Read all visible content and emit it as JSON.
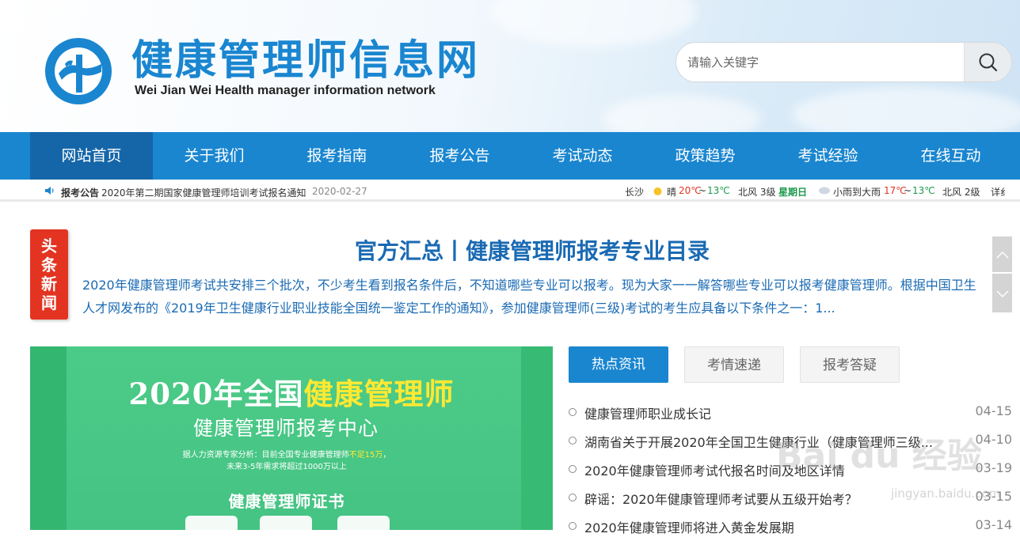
{
  "header": {
    "title": "健康管理师信息网",
    "subtitle": "Wei Jian Wei Health manager information network",
    "search_placeholder": "请输入关键字"
  },
  "nav": {
    "items": [
      "网站首页",
      "关于我们",
      "报考指南",
      "报考公告",
      "考试动态",
      "政策趋势",
      "考试经验",
      "在线互动"
    ],
    "active_index": 0
  },
  "ticker": {
    "label": "报考公告",
    "headline": "2020年第二期国家健康管理师培训考试报名通知",
    "date": "2020-02-27"
  },
  "weather": {
    "city": "长沙",
    "today_cond": "晴",
    "today_high": "20℃",
    "today_sep": "~",
    "today_low": "13℃",
    "today_wind": "北风 3级",
    "weekday": "星期日",
    "tomorrow_cond": "小雨到大雨",
    "tomorrow_high": "17℃",
    "tomorrow_sep": "~",
    "tomorrow_low": "13℃",
    "tomorrow_wind": "北风 2级",
    "more": "详纟"
  },
  "headline": {
    "badge": [
      "头",
      "条",
      "新",
      "闻"
    ],
    "title": "官方汇总丨健康管理师报考专业目录",
    "body": "2020年健康管理师考试共安排三个批次，不少考生看到报名条件后，不知道哪些专业可以报考。现为大家一一解答哪些专业可以报考健康管理师。根据中国卫生人才网发布的《2019年卫生健康行业职业技能全国统一鉴定工作的通知》，参加健康管理师(三级)考试的考生应具备以下条件之一：1..."
  },
  "banner": {
    "title_prefix": "2020年全国",
    "title_highlight": "健康管理师",
    "subtitle": "健康管理师报考中心",
    "note_line1_prefix": "据人力资源专家分析：目前全国专业健康管理师",
    "note_line1_highlight": "不足15万",
    "note_line1_suffix": "，",
    "note_line2": "未来3-5年需求将超过1000万以上",
    "cert": "健康管理师证书"
  },
  "tabs": [
    "热点资讯",
    "考情速递",
    "报考答疑"
  ],
  "news": [
    {
      "title": "健康管理师职业成长记",
      "date": "04-15"
    },
    {
      "title": "湖南省关于开展2020年全国卫生健康行业（健康管理师三级...",
      "date": "04-10"
    },
    {
      "title": "2020年健康管理师考试代报名时间及地区详情",
      "date": "03-19"
    },
    {
      "title": "辟谣：2020年健康管理师考试要从五级开始考？",
      "date": "03-15"
    },
    {
      "title": "2020年健康管理师将进入黄金发展期",
      "date": "03-14"
    }
  ],
  "watermark": {
    "text": "Bai du 经验",
    "url": "jingyan.baidu.com"
  },
  "colors": {
    "brand": "#1a86d0",
    "nav_active": "#1566a8",
    "badge": "#e33421",
    "banner": "#45c383",
    "highlight": "#ffe933"
  }
}
